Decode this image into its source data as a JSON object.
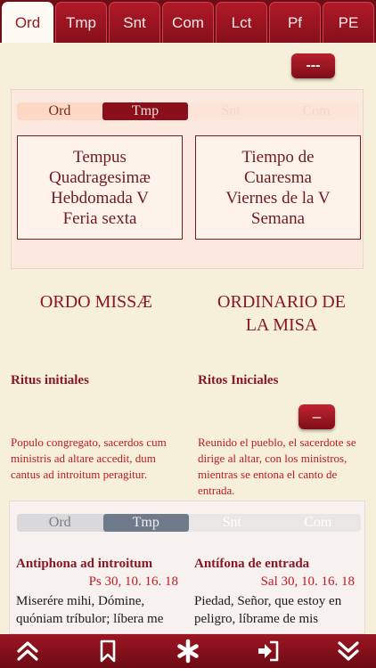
{
  "tabs": [
    "Ord",
    "Tmp",
    "Snt",
    "Com",
    "Lct",
    "Pf",
    "PE"
  ],
  "collapse_label": "---",
  "context_segments": [
    "Ord",
    "Tmp",
    "Snt",
    "Com"
  ],
  "context": {
    "latin": [
      "Tempus",
      "Quadragesimæ",
      "Hebdomada V",
      "Feria sexta"
    ],
    "spanish": [
      "Tiempo de",
      "Cuaresma",
      "Viernes de la V",
      "Semana"
    ]
  },
  "titles": {
    "latin": "ORDO MISSÆ",
    "spanish_line1": "ORDINARIO DE",
    "spanish_line2": "LA MISA"
  },
  "subtitles": {
    "latin": "Ritus initiales",
    "spanish": "Ritos Iniciales"
  },
  "minus_label": "–",
  "rubric": {
    "latin": "Populo congregato, sacerdos cum ministris ad altare accedit, dum cantus ad introitum peragitur.",
    "spanish": "Reunido el pueblo, el sacerdote se dirige al altar, con los ministros, mientras se entona el canto de entrada."
  },
  "proper_segments": [
    "Ord",
    "Tmp",
    "Snt",
    "Com"
  ],
  "antiphon": {
    "latin_heading": "Antiphona ad introitum",
    "spanish_heading": "Antífona de entrada",
    "latin_ref": "Ps 30, 10. 16. 18",
    "spanish_ref": "Sal 30, 10. 16. 18",
    "latin_text": "Miserére mihi, Dómine, quóniam tríbulor; líbera me",
    "spanish_text": "Piedad, Señor, que estoy en peligro, líbrame de mis"
  },
  "bottom_icons": [
    "double-chevron-up-icon",
    "bookmark-icon",
    "asterisk-icon",
    "sign-in-icon",
    "double-chevron-down-icon"
  ],
  "colors": {
    "accent": "#8a1722",
    "tab_bar": "#6e0d15",
    "rubric_red": "#c3191f",
    "background": "#f6efd9"
  }
}
